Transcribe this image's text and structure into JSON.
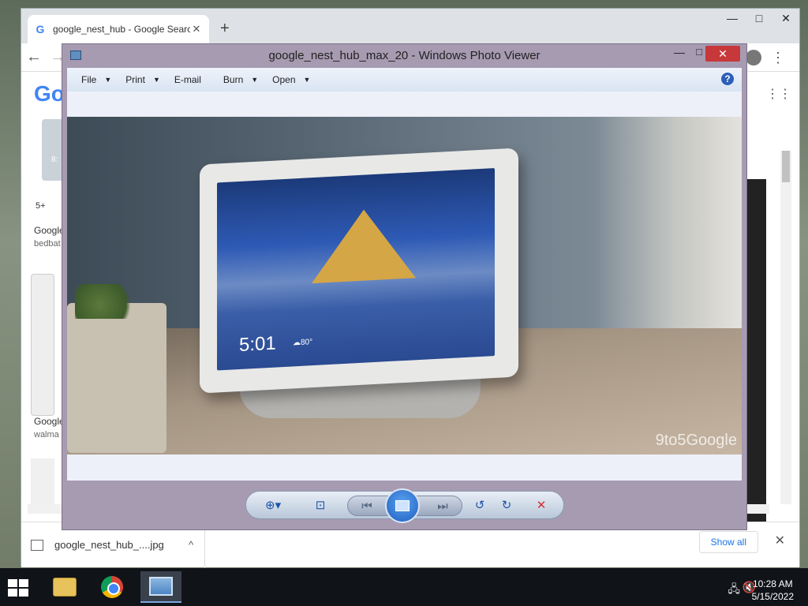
{
  "chrome": {
    "tab_title": "google_nest_hub - Google Search",
    "tab_close": "✕",
    "new_tab": "+",
    "win_minimize": "—",
    "win_maximize": "□",
    "win_close": "✕",
    "back_icon": "←",
    "forward_icon": "→",
    "menu_icon": "⋮",
    "apps_icon": "⋮⋮",
    "google_logo": "Go",
    "left_badge": "8:",
    "tag_label": "5+",
    "result1_title": "Google",
    "result1_source": "bedbat",
    "result2_title": "Google",
    "result2_source": "walma",
    "download_file": "google_nest_hub_....jpg",
    "download_chevron": "^",
    "show_all": "Show all",
    "download_close": "✕"
  },
  "viewer": {
    "title": "google_nest_hub_max_20 - Windows Photo Viewer",
    "min": "—",
    "max": "□",
    "close": "✕",
    "menus": [
      {
        "label": "File",
        "arrow": "▼"
      },
      {
        "label": "Print",
        "arrow": "▼"
      },
      {
        "label": "E-mail",
        "arrow": ""
      },
      {
        "label": "Burn",
        "arrow": "▼"
      },
      {
        "label": "Open",
        "arrow": "▼"
      }
    ],
    "help": "?",
    "photo": {
      "time": "5:01",
      "temp": "☁80°",
      "watermark": "9to5Google"
    },
    "controls": {
      "zoom": "⊕▾",
      "fit": "⊡",
      "prev": "⏮",
      "next": "⏭",
      "rotate_ccw": "↺",
      "rotate_cw": "↻",
      "delete": "✕"
    }
  },
  "taskbar": {
    "clock_time": "10:28 AM",
    "clock_date": "5/15/2022",
    "network_icon": "🖧",
    "volume_icon": "🔇"
  },
  "icons": {
    "start": "windows-logo-icon",
    "file_explorer": "folder-icon",
    "chrome": "chrome-icon",
    "photo_viewer": "photo-viewer-icon"
  }
}
